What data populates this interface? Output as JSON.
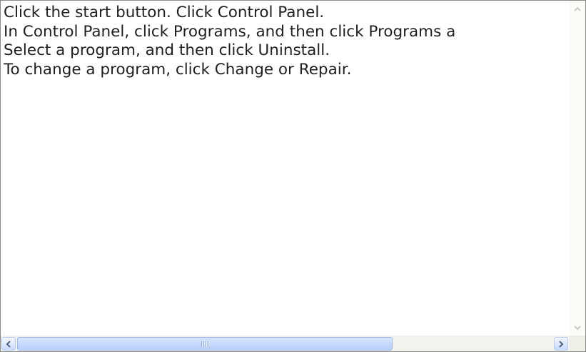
{
  "textarea": {
    "lines": [
      "Click the start button. Click Control Panel.",
      "In Control Panel, click Programs, and then click Programs a",
      "Select a program, and then click Uninstall.",
      "To change a program, click Change or Repair."
    ]
  },
  "scrollbars": {
    "horizontal_thumb_fraction": 0.72,
    "horizontal_position": 0.0,
    "vertical_enabled": false
  },
  "icons": {
    "up": "chevron-up-icon",
    "down": "chevron-down-icon",
    "left": "chevron-left-icon",
    "right": "chevron-right-icon",
    "grip": "grip-icon"
  },
  "colors": {
    "border": "#8a8a8a",
    "text": "#202020",
    "scroll_thumb": "#c8d9fb",
    "arrow": "#4d6185",
    "disabled_arrow": "#c9c9c0"
  }
}
